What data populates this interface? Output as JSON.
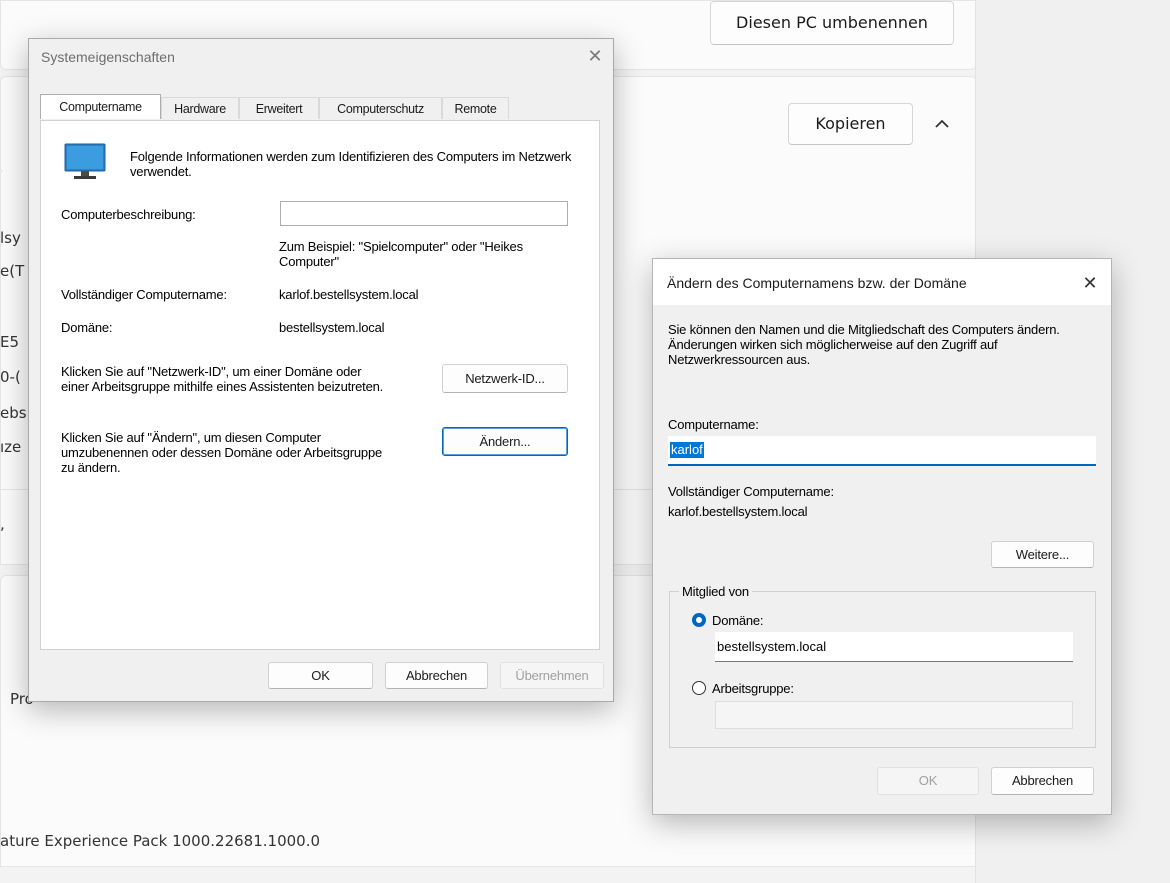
{
  "background": {
    "rename_pc_button": "Diesen PC umbenennen",
    "copy_button": "Kopieren",
    "collapse_icon": "chevron-up-icon",
    "text_fragments": [
      "lsy",
      "e(T",
      "E5",
      "0-(",
      "ebs",
      "ıze",
      ",",
      "Pro"
    ],
    "experience_pack": "ature Experience Pack 1000.22681.1000.0"
  },
  "system_properties": {
    "title": "Systemeigenschaften",
    "tabs": [
      "Computername",
      "Hardware",
      "Erweitert",
      "Computerschutz",
      "Remote"
    ],
    "active_tab": 0,
    "monitor_icon": "monitor-icon",
    "intro": "Folgende Informationen werden zum Identifizieren des Computers im Netzwerk verwendet.",
    "description_label": "Computerbeschreibung:",
    "description_value": "",
    "example_text": "Zum Beispiel: \"Spielcomputer\" oder \"Heikes Computer\"",
    "fullname_label": "Vollständiger Computername:",
    "fullname_value": "karlof.bestellsystem.local",
    "domain_label": "Domäne:",
    "domain_value": "bestellsystem.local",
    "network_id_text": "Klicken Sie auf \"Netzwerk-ID\", um einer Domäne oder einer Arbeitsgruppe mithilfe eines Assistenten beizutreten.",
    "network_id_button": "Netzwerk-ID...",
    "change_text": "Klicken Sie auf \"Ändern\", um diesen Computer umzubenennen oder dessen Domäne oder Arbeitsgruppe zu ändern.",
    "change_button": "Ändern...",
    "ok_button": "OK",
    "cancel_button": "Abbrechen",
    "apply_button": "Übernehmen"
  },
  "rename_dialog": {
    "title": "Ändern des Computernamens bzw. der Domäne",
    "intro": "Sie können den Namen und die Mitgliedschaft des Computers ändern. Änderungen wirken sich möglicherweise auf den Zugriff auf Netzwerkressourcen aus.",
    "computername_label": "Computername:",
    "computername_value": "karlof",
    "fullname_label": "Vollständiger Computername:",
    "fullname_value": "karlof.bestellsystem.local",
    "more_button": "Weitere...",
    "member_of_label": "Mitglied von",
    "domain_radio_label": "Domäne:",
    "domain_selected": true,
    "domain_value": "bestellsystem.local",
    "workgroup_radio_label": "Arbeitsgruppe:",
    "workgroup_value": "",
    "ok_button": "OK",
    "cancel_button": "Abbrechen"
  }
}
